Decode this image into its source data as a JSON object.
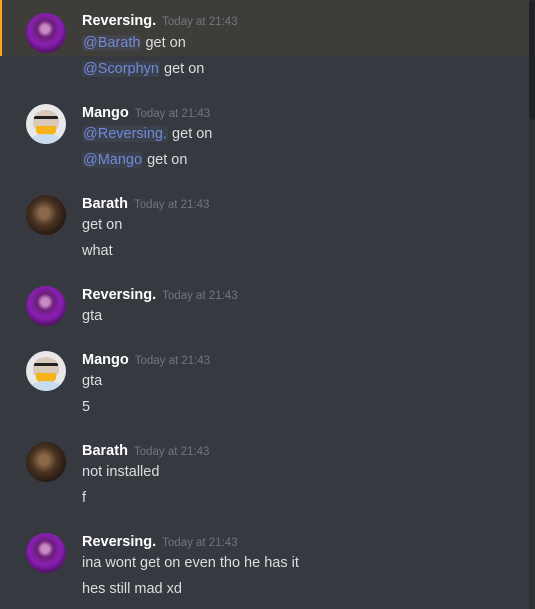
{
  "colors": {
    "background": "#36393f",
    "highlight_background": "#3f3d3a",
    "highlight_bar": "#faa61a",
    "username": "#ffffff",
    "timestamp": "#72767d",
    "text": "#dcddde",
    "mention": "#7289da"
  },
  "messages": [
    {
      "author": "Reversing.",
      "timestamp": "Today at 21:43",
      "highlighted": true,
      "lines": [
        {
          "mention": "@Barath",
          "text": " get on"
        },
        {
          "mention": "@Scorphyn",
          "text": " get on"
        }
      ]
    },
    {
      "author": "Mango",
      "timestamp": "Today at 21:43",
      "lines": [
        {
          "mention": "@Reversing.",
          "text": " get on"
        },
        {
          "mention": "@Mango",
          "text": " get on"
        }
      ]
    },
    {
      "author": "Barath",
      "timestamp": "Today at 21:43",
      "lines": [
        {
          "text": "get on"
        },
        {
          "text": "what"
        }
      ]
    },
    {
      "author": "Reversing.",
      "timestamp": "Today at 21:43",
      "lines": [
        {
          "text": "gta"
        }
      ]
    },
    {
      "author": "Mango",
      "timestamp": "Today at 21:43",
      "lines": [
        {
          "text": "gta"
        },
        {
          "text": "5"
        }
      ]
    },
    {
      "author": "Barath",
      "timestamp": "Today at 21:43",
      "lines": [
        {
          "text": "not installed"
        },
        {
          "text": "f"
        }
      ]
    },
    {
      "author": "Reversing.",
      "timestamp": "Today at 21:43",
      "lines": [
        {
          "text": "ina wont get on even tho he has it"
        },
        {
          "text": "hes still mad xd"
        }
      ]
    }
  ]
}
